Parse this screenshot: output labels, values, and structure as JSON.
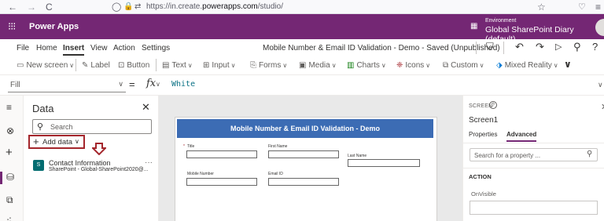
{
  "browser": {
    "back_icon": "←",
    "forward_icon": "→",
    "reload_icon": "C",
    "url_prefix": "https://in.create.",
    "url_domain": "powerapps.com",
    "url_suffix": "/studio/"
  },
  "appbar": {
    "app_name": "Power Apps",
    "environment_label": "Environment",
    "environment_name": "Global SharePoint Diary (default)"
  },
  "menu": {
    "items": [
      "File",
      "Home",
      "Insert",
      "View",
      "Action",
      "Settings"
    ],
    "document_title": "Mobile Number & Email ID Validation - Demo - Saved (Unpublished)"
  },
  "ribbon": {
    "items": [
      {
        "icon": "new-screen-icon",
        "label": "New screen"
      },
      {
        "icon": "label-icon",
        "label": "Label"
      },
      {
        "icon": "button-icon",
        "label": "Button"
      },
      {
        "icon": "text-icon",
        "label": "Text"
      },
      {
        "icon": "input-icon",
        "label": "Input"
      },
      {
        "icon": "forms-icon",
        "label": "Forms"
      },
      {
        "icon": "media-icon",
        "label": "Media"
      },
      {
        "icon": "charts-icon",
        "label": "Charts"
      },
      {
        "icon": "icons-icon",
        "label": "Icons"
      },
      {
        "icon": "custom-icon",
        "label": "Custom"
      },
      {
        "icon": "mixed-reality-icon",
        "label": "Mixed Reality"
      }
    ]
  },
  "formula_bar": {
    "property": "Fill",
    "equals": "=",
    "fx": "fx",
    "formula": "White"
  },
  "data_panel": {
    "title": "Data",
    "search_placeholder": "Search",
    "add_data_label": "Add data",
    "connection_name": "Contact Information",
    "connection_source": "SharePoint - Global-SharePoint2020@..."
  },
  "canvas": {
    "screen_title": "Mobile Number & Email ID Validation - Demo",
    "fields": {
      "title_label": "Title",
      "first_name_label": "First Name",
      "last_name_label": "Last Name",
      "mobile_label": "Mobile Number",
      "email_label": "Email ID"
    }
  },
  "right_panel": {
    "kind": "SCREEN",
    "name": "Screen1",
    "tab_properties": "Properties",
    "tab_advanced": "Advanced",
    "search_placeholder": "Search for a property ...",
    "section": "ACTION",
    "property": "OnVisible"
  },
  "colors": {
    "brand": "#742774",
    "header_blue": "#3c6cb4",
    "highlight_red": "#a4262c"
  }
}
